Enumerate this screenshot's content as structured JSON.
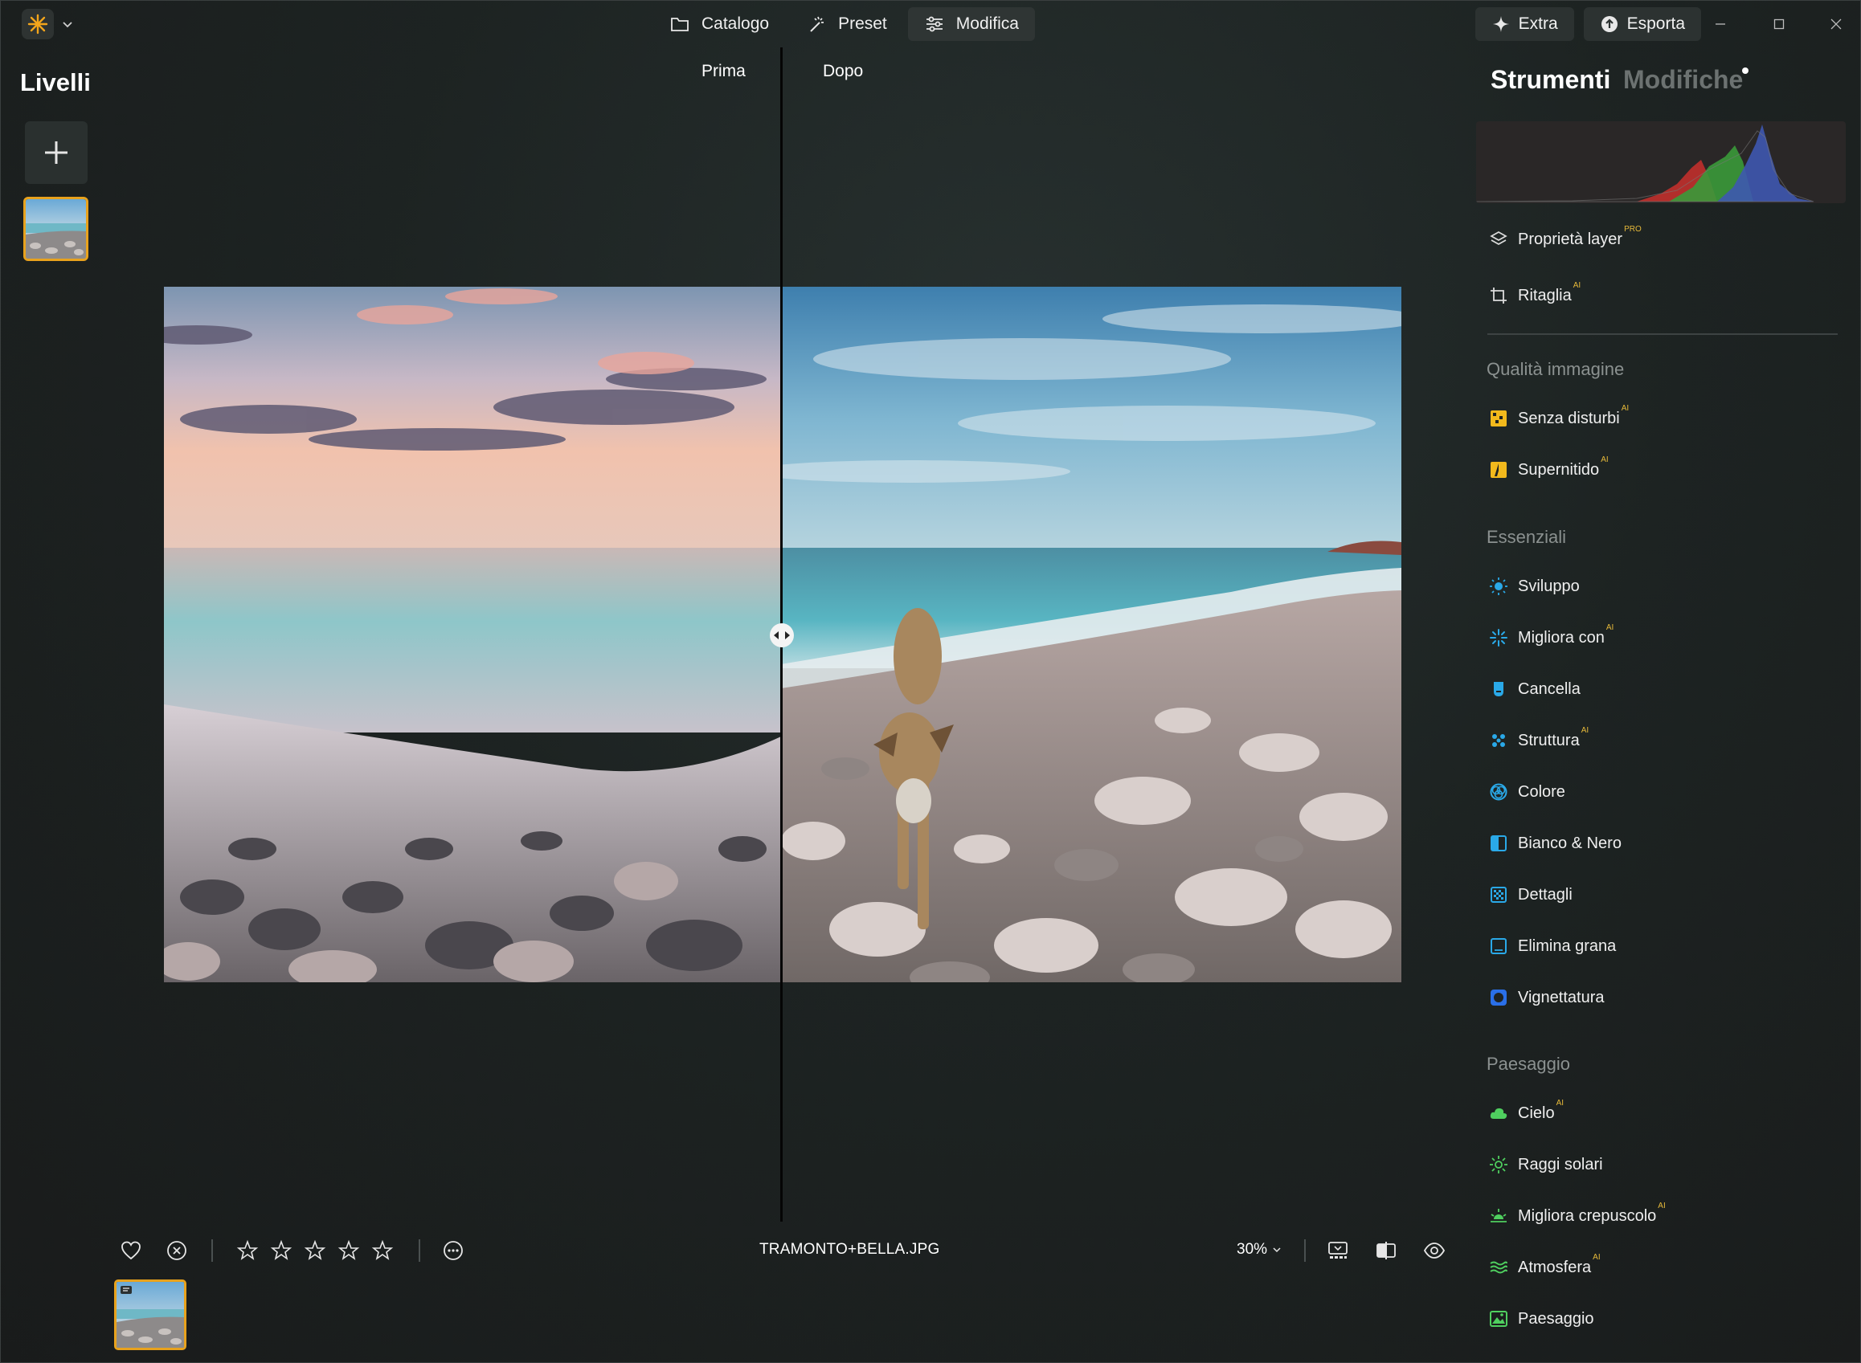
{
  "nav": {
    "tabs": [
      {
        "label": "Catalogo",
        "icon": "folder-icon"
      },
      {
        "label": "Preset",
        "icon": "magic-wand-icon"
      },
      {
        "label": "Modifica",
        "icon": "sliders-icon"
      }
    ],
    "active_tab": "Modifica",
    "extra_label": "Extra",
    "export_label": "Esporta"
  },
  "left_panel": {
    "title": "Livelli"
  },
  "compare": {
    "before_label": "Prima",
    "after_label": "Dopo"
  },
  "bottom_bar": {
    "filename": "TRAMONTO+BELLA.JPG",
    "zoom": "30%",
    "rating": 0,
    "stars_total": 5
  },
  "right_panel": {
    "tab_tools": "Strumenti",
    "tab_edits": "Modifiche",
    "top_tools": [
      {
        "label": "Proprietà layer",
        "badge": "PRO",
        "icon": "layers-icon"
      },
      {
        "label": "Ritaglia",
        "badge": "AI",
        "icon": "crop-icon"
      }
    ],
    "sections": [
      {
        "title": "Qualità immagine",
        "tools": [
          {
            "label": "Senza disturbi",
            "badge": "AI",
            "icon": "denoise-icon"
          },
          {
            "label": "Supernitido",
            "badge": "AI",
            "icon": "supersharp-icon"
          }
        ]
      },
      {
        "title": "Essenziali",
        "tools": [
          {
            "label": "Sviluppo",
            "badge": "",
            "icon": "sun-develop-icon"
          },
          {
            "label": "Migliora con",
            "badge": "AI",
            "icon": "sparkle-enhance-icon"
          },
          {
            "label": "Cancella",
            "badge": "",
            "icon": "eraser-icon"
          },
          {
            "label": "Struttura",
            "badge": "AI",
            "icon": "structure-icon"
          },
          {
            "label": "Colore",
            "badge": "",
            "icon": "color-icon"
          },
          {
            "label": "Bianco & Nero",
            "badge": "",
            "icon": "black-white-icon"
          },
          {
            "label": "Dettagli",
            "badge": "",
            "icon": "details-icon"
          },
          {
            "label": "Elimina grana",
            "badge": "",
            "icon": "grain-icon"
          },
          {
            "label": "Vignettatura",
            "badge": "",
            "icon": "vignette-icon"
          }
        ]
      },
      {
        "title": "Paesaggio",
        "tools": [
          {
            "label": "Cielo",
            "badge": "AI",
            "icon": "cloud-icon"
          },
          {
            "label": "Raggi solari",
            "badge": "",
            "icon": "sunrays-icon"
          },
          {
            "label": "Migliora crepuscolo",
            "badge": "AI",
            "icon": "sunset-icon"
          },
          {
            "label": "Atmosfera",
            "badge": "AI",
            "icon": "atmosphere-icon"
          },
          {
            "label": "Paesaggio",
            "badge": "",
            "icon": "landscape-icon"
          }
        ]
      }
    ]
  },
  "colors": {
    "accent": "#e8a21d",
    "ai_badge": "#e6b93a"
  }
}
